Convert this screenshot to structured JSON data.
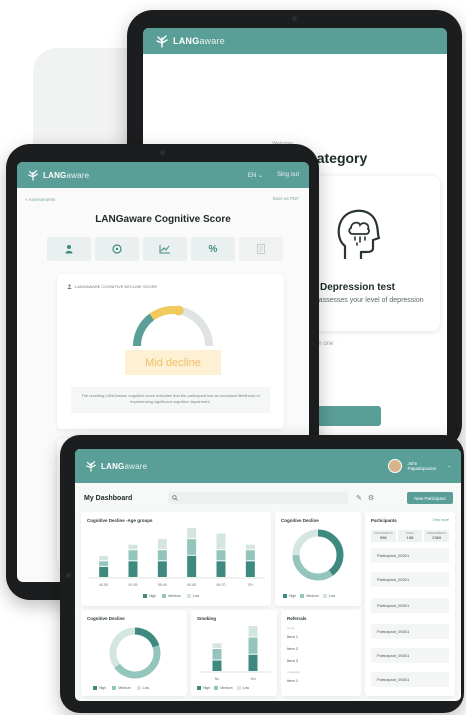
{
  "brand": {
    "name_strong": "LANG",
    "name_light": "aware"
  },
  "colors": {
    "primary": "#5a9f97",
    "high": "#3f8a80",
    "medium": "#94c5bc",
    "low": "#d5e6e2",
    "accent": "#f2c95c"
  },
  "category_screen": {
    "kicker": "Welcome",
    "title": "Select test category",
    "card_title": "Depression test",
    "card_description": "The test assesses your level of depression",
    "hint": "ction one"
  },
  "score_screen": {
    "lang": "EN",
    "signout": "Sing out",
    "back": "< Assessments",
    "pdf": "Save as PDF",
    "title": "LANGaware Cognitive Score",
    "tabs": [
      "person-icon",
      "info-icon",
      "chart-icon",
      "percent-icon",
      "document-icon"
    ],
    "card_label": "LANGAWARE COGNITIVE DECLINE SCORE",
    "gauge_level": 0.55,
    "result": "Mid decline",
    "note": "The resulting LANGaware cognitive score indicates that the participant has an increased likelihood of experiencing significant cognitive impairment."
  },
  "dashboard": {
    "user_first": "John",
    "user_last": "Papadopoulos",
    "title": "My Dashboard",
    "new_button": "New Participant",
    "legend": [
      "High",
      "Medium",
      "Low"
    ],
    "age_panel": {
      "title": "Cognitive Decline -Age groups",
      "categories": [
        "40-50",
        "50-55",
        "55-60",
        "60-65",
        "65-70",
        "70+"
      ]
    },
    "cd_panel": {
      "title": "Cognitive Decline"
    },
    "cd2_panel": {
      "title": "Cognitive Decline"
    },
    "smoke_panel": {
      "title": "Smoking",
      "categories": [
        "No",
        "Yes"
      ]
    },
    "ref_panel": {
      "title": "Referrals",
      "sub": "Today",
      "items": [
        "Item 1",
        "Item 2",
        "Item 3",
        "Item 1"
      ],
      "sub2": "Yesterday"
    },
    "participants": {
      "title": "Participants",
      "view_all": "View more",
      "stats": [
        {
          "label": "PARTICIPANTS",
          "value": "956"
        },
        {
          "label": "TODAY",
          "value": "198"
        },
        {
          "label": "ASSESSMENTS",
          "value": "2369"
        }
      ],
      "items": [
        "Participant_00001",
        "Participant_00001",
        "Participant_00001",
        "Participant_00001",
        "Participant_00001",
        "Participant_00001"
      ]
    }
  },
  "chart_data": [
    {
      "type": "bar",
      "title": "Cognitive Decline -Age groups",
      "categories": [
        "40-50",
        "50-55",
        "55-60",
        "60-65",
        "65-70",
        "70+"
      ],
      "series": [
        {
          "name": "High",
          "values": [
            2,
            3,
            3,
            4,
            3,
            3
          ]
        },
        {
          "name": "Medium",
          "values": [
            1,
            2,
            2,
            3,
            2,
            2
          ]
        },
        {
          "name": "Low",
          "values": [
            1,
            1,
            2,
            2,
            3,
            1
          ]
        }
      ]
    },
    {
      "type": "pie",
      "title": "Cognitive Decline",
      "categories": [
        "High",
        "Medium",
        "Low"
      ],
      "values": [
        40,
        35,
        25
      ]
    },
    {
      "type": "pie",
      "title": "Cognitive Decline",
      "categories": [
        "High",
        "Medium",
        "Low"
      ],
      "values": [
        20,
        45,
        35
      ]
    },
    {
      "type": "bar",
      "title": "Smoking",
      "categories": [
        "No",
        "Yes"
      ],
      "series": [
        {
          "name": "High",
          "values": [
            2,
            3
          ]
        },
        {
          "name": "Medium",
          "values": [
            2,
            3
          ]
        },
        {
          "name": "Low",
          "values": [
            1,
            2
          ]
        }
      ]
    }
  ]
}
